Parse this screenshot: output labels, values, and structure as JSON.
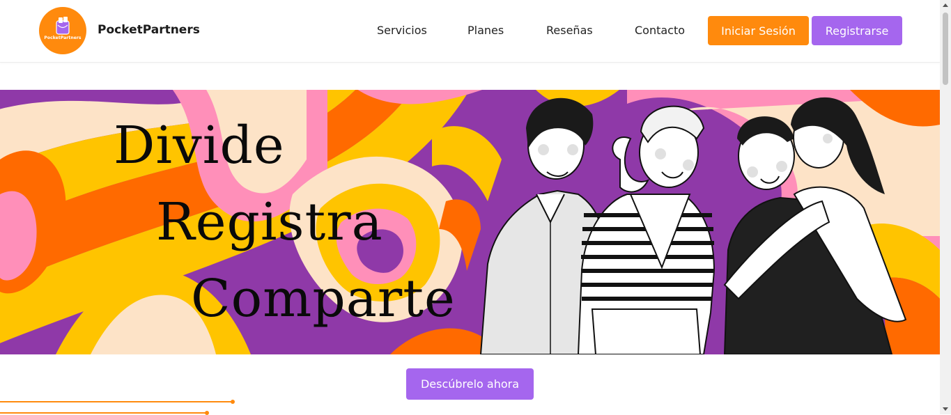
{
  "brand": {
    "name": "PocketPartners",
    "logo_text": "PocketPartners",
    "logo_icon": "wallet-icon"
  },
  "nav": {
    "items": [
      {
        "label": "Servicios"
      },
      {
        "label": "Planes"
      },
      {
        "label": "Reseñas"
      },
      {
        "label": "Contacto"
      }
    ],
    "login_label": "Iniciar Sesión",
    "register_label": "Registrarse"
  },
  "hero": {
    "words": [
      "Divide",
      "Registra",
      "Comparte"
    ],
    "illustration": "group-of-friends-illustration"
  },
  "cta": {
    "label": "Descúbrelo ahora"
  },
  "colors": {
    "orange": "#ff8a0d",
    "purple": "#a566ee",
    "hero_purple": "#8f39a8",
    "hero_pink": "#ff8fb9",
    "hero_yellow": "#ffc400",
    "hero_cream": "#fde3c7",
    "hero_orange": "#ff6a00"
  }
}
